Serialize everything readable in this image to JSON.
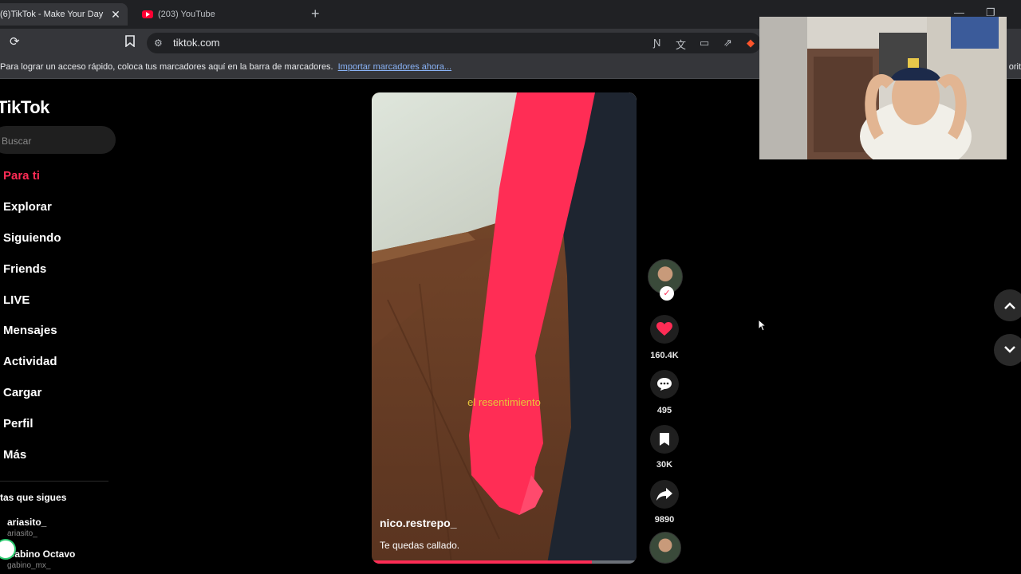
{
  "browser": {
    "tabs": [
      {
        "title": "(6)TikTok - Make Your Day",
        "active": true
      },
      {
        "title": "(203) YouTube",
        "active": false
      }
    ],
    "url": "tiktok.com",
    "bookmarks_bar": {
      "message": "Para lograr un acceso rápido, coloca tus marcadores aquí en la barra de marcadores.",
      "link": "Importar marcadores ahora...",
      "right_text": "orit"
    }
  },
  "tiktok": {
    "logo": "TikTok",
    "search": {
      "placeholder": "Buscar"
    },
    "nav": [
      "Para ti",
      "Explorar",
      "Siguiendo",
      "Friends",
      "LIVE",
      "Mensajes",
      "Actividad",
      "Cargar",
      "Perfil",
      "Más"
    ],
    "following_title": "tas que sigues",
    "accounts": [
      {
        "name": "ariasito_",
        "handle": "ariasito_"
      },
      {
        "name": "Gabino Octavo",
        "handle": "gabino_mx_"
      }
    ],
    "video": {
      "caption_overlay": "el resentimiento",
      "author": "nico.restrepo_",
      "description": "Te quedas callado.",
      "progress": 0.83
    },
    "actions": {
      "likes": "160.4K",
      "comments": "495",
      "saves": "30K",
      "shares": "9890"
    },
    "colors": {
      "accent": "#fe2c55"
    }
  }
}
